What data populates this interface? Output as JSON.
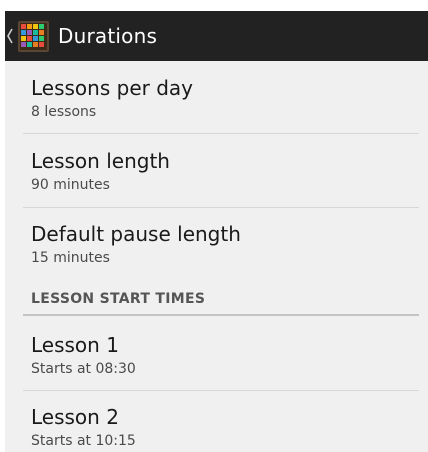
{
  "action_bar": {
    "title": "Durations",
    "background": "#222222",
    "up_icon": "chevron-left-icon",
    "app_icon": "color-grid-icon"
  },
  "preferences": [
    {
      "title": "Lessons per day",
      "summary": "8 lessons"
    },
    {
      "title": "Lesson length",
      "summary": "90 minutes"
    },
    {
      "title": "Default pause length",
      "summary": "15 minutes"
    }
  ],
  "category": {
    "title": "LESSON START TIMES"
  },
  "lessons": [
    {
      "title": "Lesson 1",
      "summary": "Starts at 08:30"
    },
    {
      "title": "Lesson 2",
      "summary": "Starts at 10:15"
    }
  ]
}
